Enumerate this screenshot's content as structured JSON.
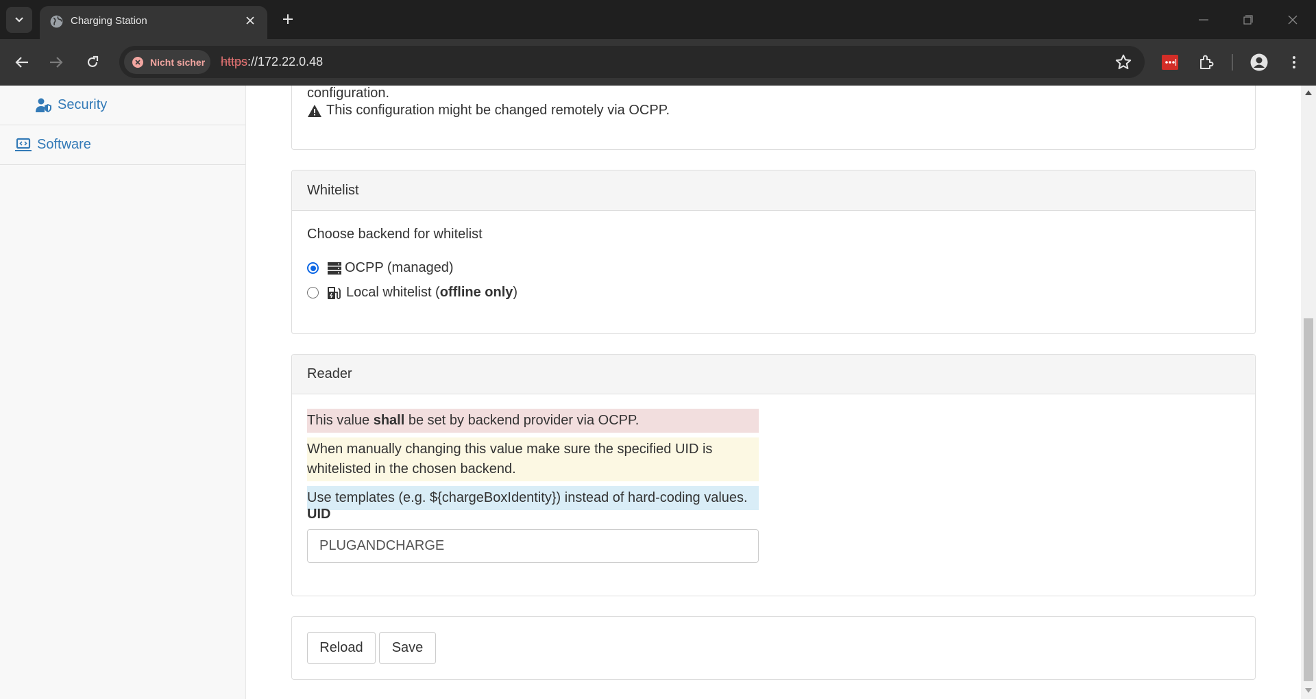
{
  "browser": {
    "tab_title": "Charging Station",
    "security_chip": "Nicht sicher",
    "url_scheme": "https",
    "url_rest": "://172.22.0.48"
  },
  "sidebar": {
    "items": [
      {
        "label": "Security",
        "icon": "user-shield-icon"
      },
      {
        "label": "Software",
        "icon": "laptop-code-icon"
      }
    ]
  },
  "main": {
    "top_panel": {
      "text_fragment": "configuration.",
      "warning": "This configuration might be changed remotely via OCPP."
    },
    "whitelist": {
      "heading": "Whitelist",
      "prompt": "Choose backend for whitelist",
      "options": [
        {
          "label": "OCPP (managed)",
          "checked": true
        },
        {
          "label_pre": "Local whitelist (",
          "label_bold": "offline only",
          "label_post": ")",
          "checked": false
        }
      ]
    },
    "reader": {
      "heading": "Reader",
      "alert_danger_pre": "This value ",
      "alert_danger_bold": "shall",
      "alert_danger_post": " be set by backend provider via OCPP.",
      "alert_warning_line1": "When manually changing this value make sure the specified UID is",
      "alert_warning_line2": "whitelisted in the chosen backend.",
      "alert_info": "Use templates (e.g. ${chargeBoxIdentity}) instead of hard-coding values.",
      "uid_label": "UID",
      "uid_value": "PLUGANDCHARGE"
    },
    "actions": {
      "reload_label": "Reload",
      "save_label": "Save"
    }
  },
  "colors": {
    "link": "#337ab7",
    "radio_accent": "#0b66e4",
    "alert_danger_bg": "#f2dede",
    "alert_warning_bg": "#fcf8e3",
    "alert_info_bg": "#d9edf7"
  }
}
